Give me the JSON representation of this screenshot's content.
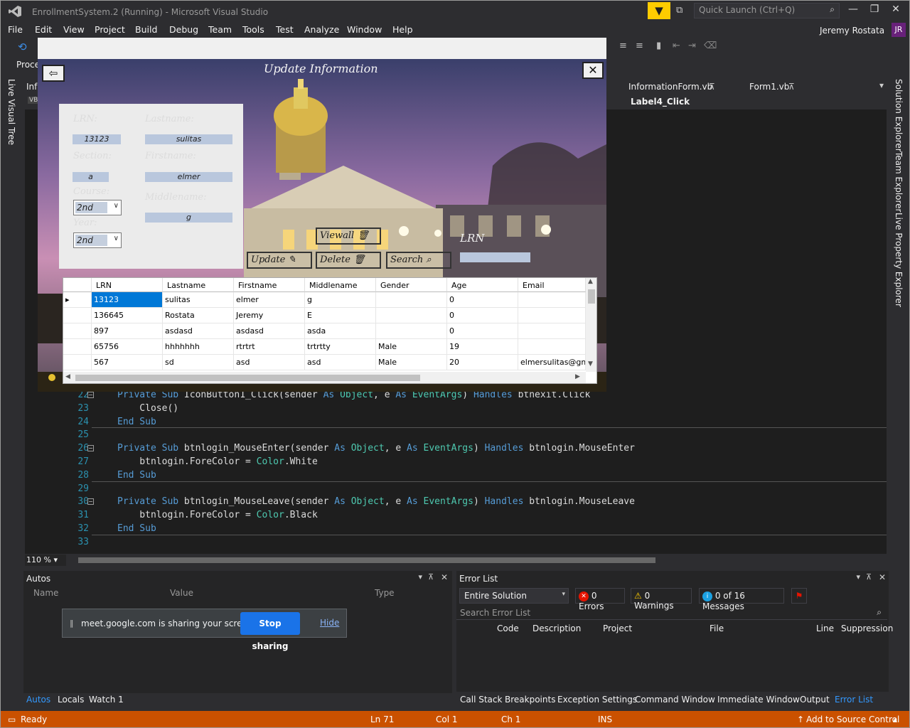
{
  "window": {
    "title": "EnrollmentSystem.2 (Running) - Microsoft Visual Studio",
    "quick_launch_placeholder": "Quick Launch (Ctrl+Q)",
    "user": "Jeremy Rostata",
    "user_initials": "JR"
  },
  "menu": [
    "File",
    "Edit",
    "View",
    "Project",
    "Build",
    "Debug",
    "Team",
    "Tools",
    "Test",
    "Analyze",
    "Window",
    "Help"
  ],
  "toolbar": {
    "process_label": "Proce"
  },
  "side_tabs": {
    "left": "Live Visual Tree",
    "right": [
      "Solution Explorer",
      "Team Explorer",
      "Live Property Explorer"
    ]
  },
  "doc_tabs": [
    "Info",
    "InformationForm.vb",
    "Form1.vb"
  ],
  "nav_bar": {
    "member": "Label4_Click"
  },
  "code_lines": [
    {
      "n": "22",
      "tokens": [
        [
          "kw",
          "Private Sub "
        ],
        [
          "",
          "IconButton1_Click(sender "
        ],
        [
          "kw",
          "As "
        ],
        [
          "ty",
          "Object"
        ],
        [
          "",
          ", e "
        ],
        [
          "kw",
          "As "
        ],
        [
          "ty",
          "EventArgs"
        ],
        [
          "",
          ") "
        ],
        [
          "kw",
          "Handles "
        ],
        [
          "",
          "btnexit.Click"
        ]
      ]
    },
    {
      "n": "23",
      "tokens": [
        [
          "",
          "    Close()"
        ]
      ]
    },
    {
      "n": "24",
      "tokens": [
        [
          "kw",
          "End Sub"
        ]
      ]
    },
    {
      "n": "25",
      "tokens": []
    },
    {
      "n": "26",
      "tokens": [
        [
          "kw",
          "Private Sub "
        ],
        [
          "",
          "btnlogin_MouseEnter(sender "
        ],
        [
          "kw",
          "As "
        ],
        [
          "ty",
          "Object"
        ],
        [
          "",
          ", e "
        ],
        [
          "kw",
          "As "
        ],
        [
          "ty",
          "EventArgs"
        ],
        [
          "",
          ") "
        ],
        [
          "kw",
          "Handles "
        ],
        [
          "",
          "btnlogin.MouseEnter"
        ]
      ]
    },
    {
      "n": "27",
      "tokens": [
        [
          "",
          "    btnlogin.ForeColor = "
        ],
        [
          "ty",
          "Color"
        ],
        [
          "",
          ".White"
        ]
      ]
    },
    {
      "n": "28",
      "tokens": [
        [
          "kw",
          "End Sub"
        ]
      ]
    },
    {
      "n": "29",
      "tokens": []
    },
    {
      "n": "30",
      "tokens": [
        [
          "kw",
          "Private Sub "
        ],
        [
          "",
          "btnlogin_MouseLeave(sender "
        ],
        [
          "kw",
          "As "
        ],
        [
          "ty",
          "Object"
        ],
        [
          "",
          ", e "
        ],
        [
          "kw",
          "As "
        ],
        [
          "ty",
          "EventArgs"
        ],
        [
          "",
          ") "
        ],
        [
          "kw",
          "Handles "
        ],
        [
          "",
          "btnlogin.MouseLeave"
        ]
      ]
    },
    {
      "n": "31",
      "tokens": [
        [
          "",
          "    btnlogin.ForeColor = "
        ],
        [
          "ty",
          "Color"
        ],
        [
          "",
          ".Black"
        ]
      ]
    },
    {
      "n": "32",
      "tokens": [
        [
          "kw",
          "End Sub"
        ]
      ]
    },
    {
      "n": "33",
      "tokens": []
    }
  ],
  "zoom": "110 %",
  "autos": {
    "title": "Autos",
    "columns": [
      "Name",
      "Value",
      "Type"
    ],
    "tabs": [
      "Autos",
      "Locals",
      "Watch 1"
    ]
  },
  "error_list": {
    "title": "Error List",
    "scope": "Entire Solution",
    "errors": "0 Errors",
    "warnings": "0 Warnings",
    "messages": "0 of 16 Messages",
    "search_placeholder": "Search Error List",
    "columns": [
      "Code",
      "Description",
      "Project",
      "File",
      "Line",
      "Suppression"
    ],
    "tabs": [
      "Call Stack",
      "Breakpoints",
      "Exception Settings",
      "Command Window",
      "Immediate Window",
      "Output",
      "Error List"
    ]
  },
  "status": {
    "ready": "Ready",
    "line": "Ln 71",
    "col": "Col 1",
    "ch": "Ch 1",
    "ins": "INS",
    "source_control": "Add to Source Control"
  },
  "sharing": {
    "text": "meet.google.com is sharing your screen.",
    "stop": "Stop sharing",
    "hide": "Hide"
  },
  "form": {
    "heading": "Update Information",
    "labels": {
      "lrn": "LRN:",
      "section": "Section:",
      "course": "Course:",
      "year": "Year:",
      "lastname": "Lastname:",
      "firstname": "Firstname:",
      "middlename": "Middlename:",
      "search_lrn": "LRN"
    },
    "values": {
      "lrn": "13123",
      "section": "a",
      "course": "2nd",
      "year": "2nd",
      "lastname": "sulitas",
      "firstname": "elmer",
      "middlename": "g"
    },
    "buttons": {
      "viewall": "Viewall",
      "update": "Update",
      "delete": "Delete",
      "search": "Search"
    },
    "grid": {
      "columns": [
        "LRN",
        "Lastname",
        "Firstname",
        "Middlename",
        "Gender",
        "Age",
        "Email"
      ],
      "rows": [
        [
          "13123",
          "sulitas",
          "elmer",
          "g",
          "",
          "0",
          ""
        ],
        [
          "136645",
          "Rostata",
          "Jeremy",
          "E",
          "",
          "0",
          ""
        ],
        [
          "897",
          "asdasd",
          "asdasd",
          "asda",
          "",
          "0",
          ""
        ],
        [
          "65756",
          "hhhhhhh",
          "rtrtrt",
          "trtrtty",
          "Male",
          "19",
          ""
        ],
        [
          "567",
          "sd",
          "asd",
          "asd",
          "Male",
          "20",
          "elmersulitas@gm..."
        ]
      ]
    }
  }
}
